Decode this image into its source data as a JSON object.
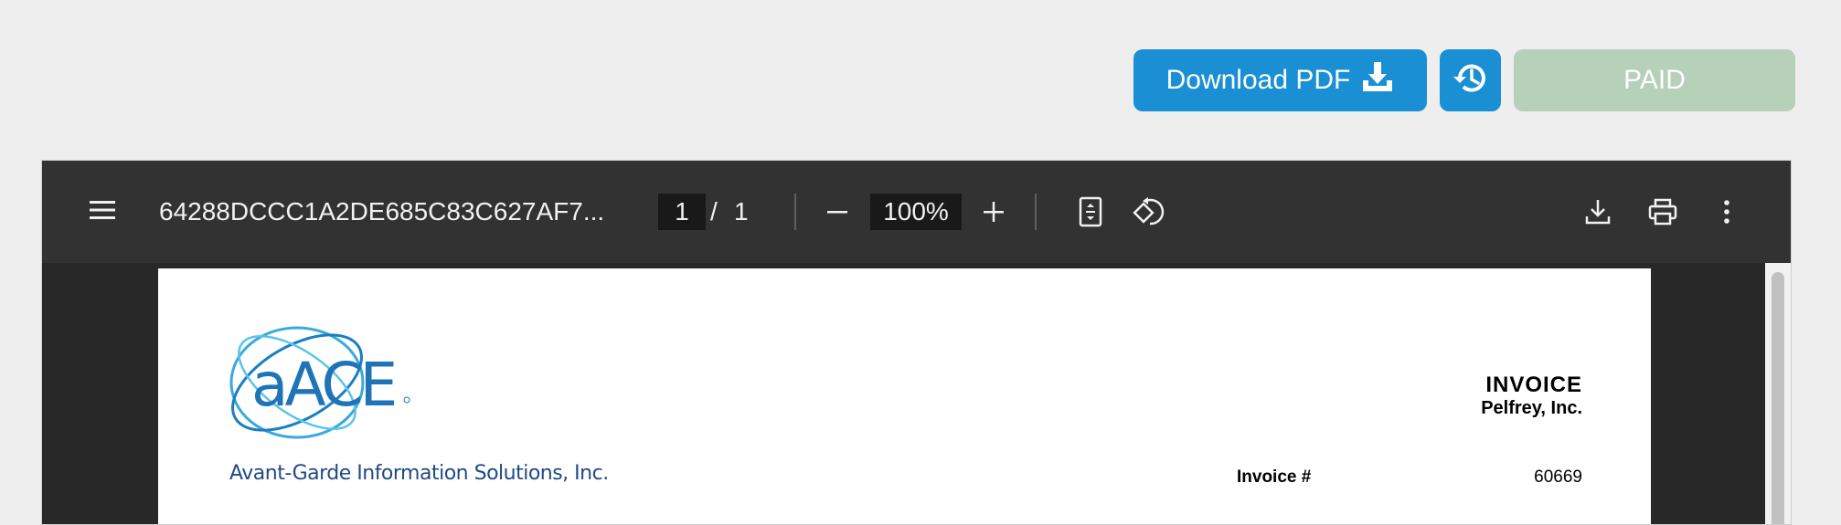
{
  "actions": {
    "download_label": "Download PDF",
    "paid_label": "PAID"
  },
  "colors": {
    "primary": "#1a8fd4",
    "paid_bg": "#b7d0b9",
    "toolbar_bg": "#323232",
    "viewer_bg": "#282828",
    "company_text": "#214a84"
  },
  "viewer": {
    "file_name": "64288DCCC1A2DE685C83C627AF7...",
    "page_current": "1",
    "page_separator": "/",
    "page_total": "1",
    "zoom": "100%",
    "icons": [
      "menu-icon",
      "zoom-out-icon",
      "zoom-in-icon",
      "fit-page-icon",
      "rotate-icon",
      "download-icon",
      "print-icon",
      "more-options-icon"
    ]
  },
  "document": {
    "logo_text": "aACE",
    "company_name": "Avant-Garde Information Solutions, Inc.",
    "invoice_title": "INVOICE",
    "client_name": "Pelfrey, Inc.",
    "invoice_number_label": "Invoice #",
    "invoice_number": "60669"
  }
}
